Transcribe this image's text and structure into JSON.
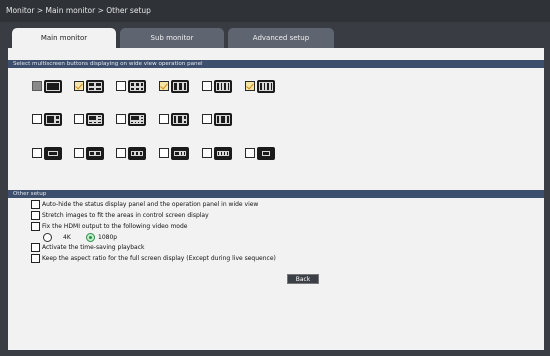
{
  "breadcrumb": "Monitor > Main monitor > Other setup",
  "tabs": [
    {
      "label": "Main monitor",
      "active": true
    },
    {
      "label": "Sub monitor",
      "active": false
    },
    {
      "label": "Advanced setup",
      "active": false
    }
  ],
  "multiscreen": {
    "header": "Select multiscreen buttons displaying on wide view operation panel",
    "rows": [
      [
        {
          "state": "disabled",
          "layout": "single"
        },
        {
          "state": "checked",
          "layout": "quad"
        },
        {
          "state": "unchecked",
          "layout": "six"
        },
        {
          "state": "checked",
          "layout": "nine"
        },
        {
          "state": "unchecked",
          "layout": "four-col"
        },
        {
          "state": "checked",
          "layout": "sixteen"
        }
      ],
      [
        {
          "state": "unchecked",
          "layout": "1+2"
        },
        {
          "state": "unchecked",
          "layout": "1+5"
        },
        {
          "state": "unchecked",
          "layout": "1+7"
        },
        {
          "state": "unchecked",
          "layout": "2+8"
        },
        {
          "state": "unchecked",
          "layout": "1+12"
        }
      ],
      [
        {
          "state": "unchecked",
          "layout": "wide-1"
        },
        {
          "state": "unchecked",
          "layout": "wide-2"
        },
        {
          "state": "unchecked",
          "layout": "wide-3"
        },
        {
          "state": "unchecked",
          "layout": "wide-4"
        },
        {
          "state": "unchecked",
          "layout": "wide-6"
        },
        {
          "state": "unchecked",
          "layout": "wide-8"
        }
      ]
    ]
  },
  "other_setup": {
    "header": "Other setup",
    "options": [
      "Auto-hide the status display panel and the operation panel in wide view",
      "Stretch images to fit the areas in control screen display",
      "Fix the HDMI output to the following video mode",
      "Activate the time-saving playback",
      "Keep the aspect ratio for the full screen display (Except during live sequence)"
    ],
    "hdmi_modes": [
      {
        "label": "4K",
        "selected": false
      },
      {
        "label": "1080p",
        "selected": true
      }
    ],
    "back_label": "Back"
  }
}
